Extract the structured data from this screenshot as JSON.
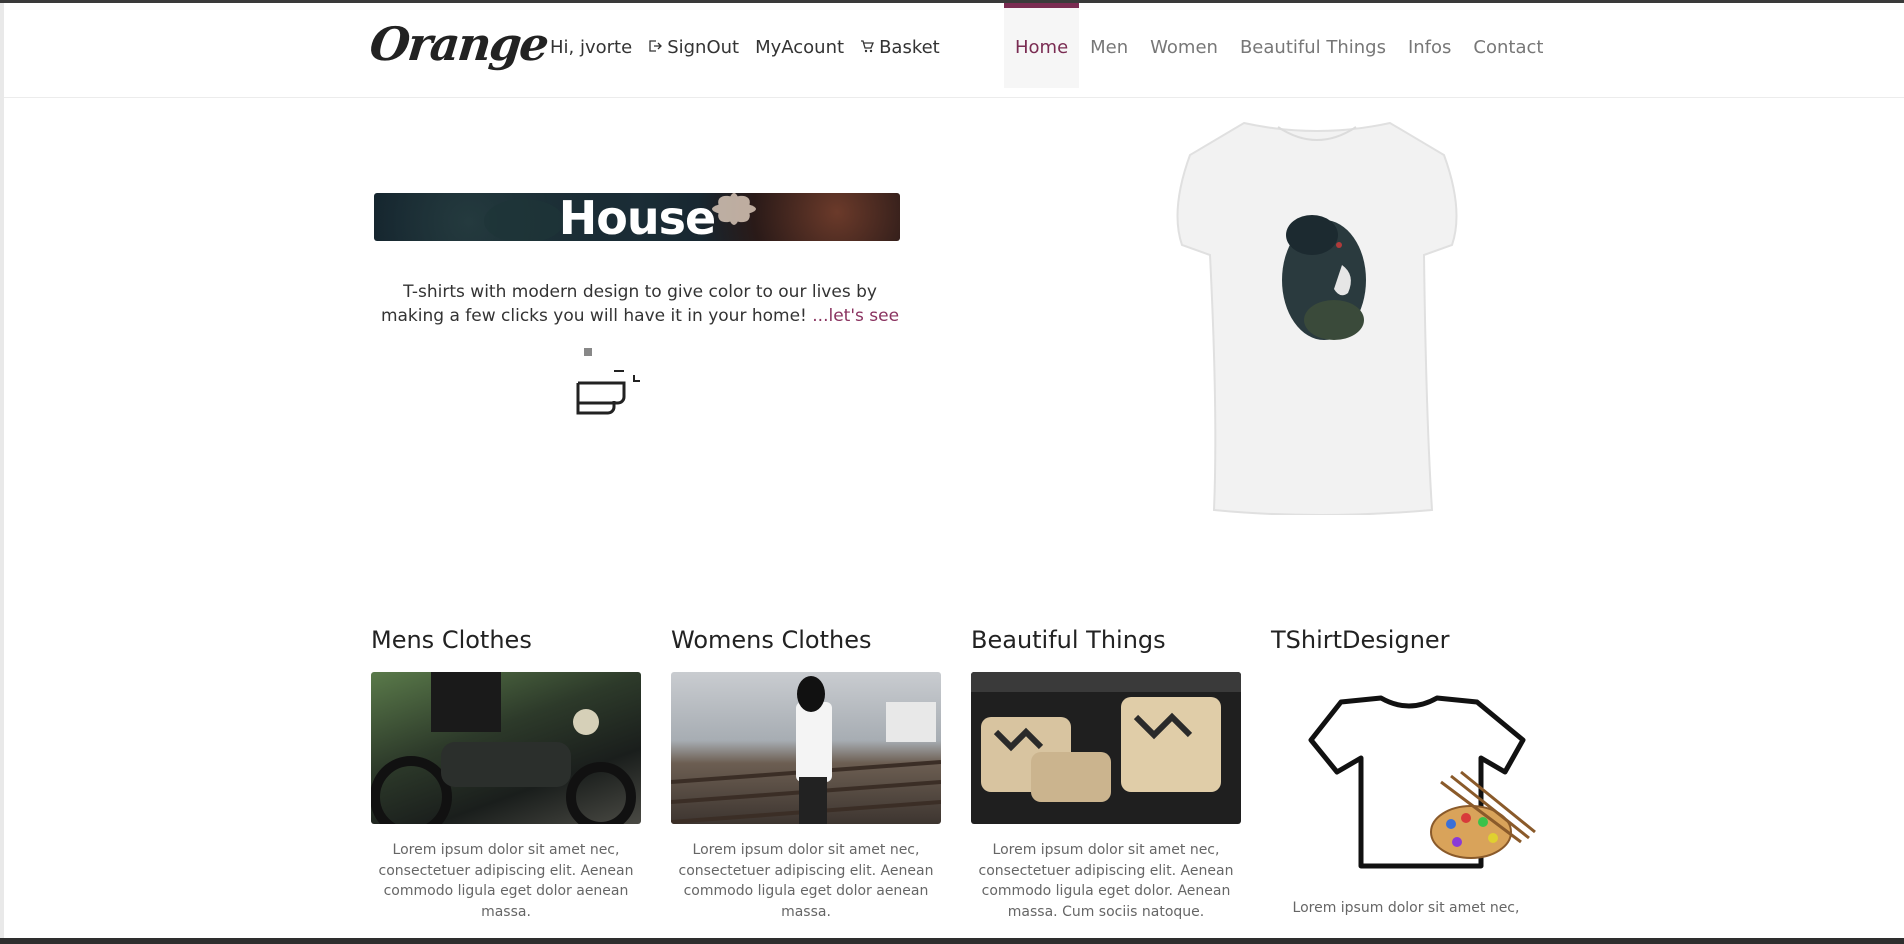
{
  "brand": {
    "logo_text": "Orange",
    "accent_color": "#7a2c52"
  },
  "user_menu": {
    "greeting": "Hi, jvorte",
    "signout": "SignOut",
    "account": "MyAcount",
    "basket": "Basket",
    "signout_icon": "signout-icon",
    "basket_icon": "cart-icon"
  },
  "main_nav": {
    "home": "Home",
    "men": "Men",
    "women": "Women",
    "beautiful_things": "Beautiful Things",
    "infos": "Infos",
    "contact": "Contact",
    "active": "Home"
  },
  "hero": {
    "banner_title": "House",
    "intro_text": "T-shirts with modern design to give color to our lives by making a few clicks you will have it in your home!",
    "more_link": " ...let's see"
  },
  "categories": [
    {
      "title": "Mens Clothes",
      "text": "Lorem ipsum dolor sit amet nec, consectetuer adipiscing elit. Aenean commodo ligula eget dolor aenean massa."
    },
    {
      "title": "Womens Clothes",
      "text": "Lorem ipsum dolor sit amet nec, consectetuer adipiscing elit. Aenean commodo ligula eget dolor aenean massa."
    },
    {
      "title": "Beautiful Things",
      "text": "Lorem ipsum dolor sit amet nec, consectetuer adipiscing elit. Aenean commodo ligula eget dolor. Aenean massa. Cum sociis natoque."
    },
    {
      "title": "TShirtDesigner",
      "text": "Lorem ipsum dolor sit amet nec,"
    }
  ]
}
